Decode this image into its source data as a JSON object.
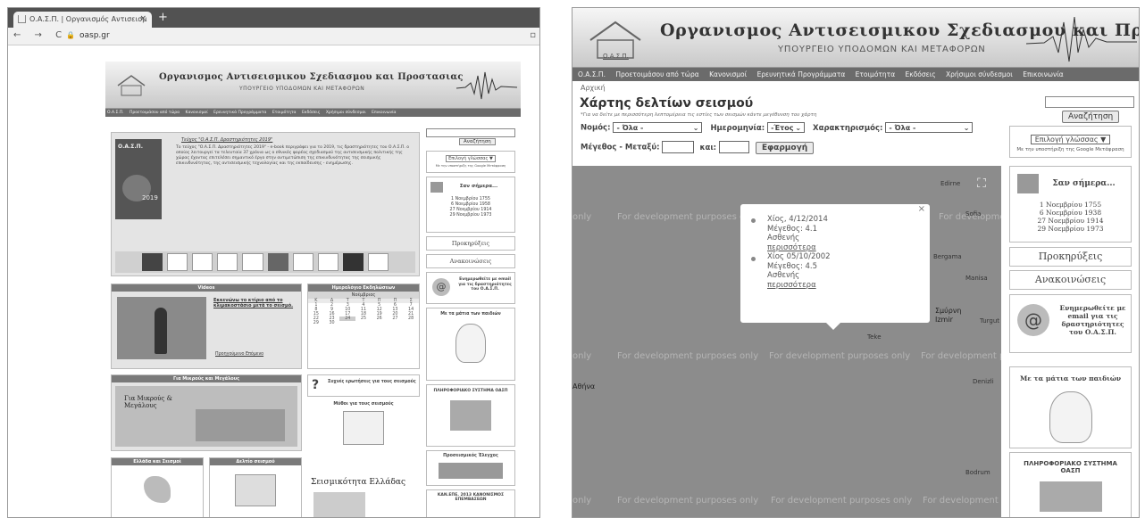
{
  "left": {
    "tab_title": "Ο.Α.Σ.Π. | Οργανισμός Αντισεισμ",
    "tab_close": "×",
    "new_tab": "+",
    "nav_glyphs": "← → C",
    "lock_icon": "🔒",
    "url": "oasp.gr",
    "site": {
      "title": "Οργανισμος Αντισεισμικου Σχεδιασμου και Προστασιας",
      "subtitle": "ΥΠΟΥΡΓΕΙΟ ΥΠΟΔΟΜΩΝ ΚΑΙ ΜΕΤΑΦΟΡΩΝ",
      "nav": [
        "Ο.Α.Σ.Π.",
        "Προετοιμάσου από τώρα",
        "Κανονισμοί",
        "Ερευνητικά Προγράμματα",
        "Ετοιμότητα",
        "Εκδόσεις",
        "Χρήσιμοι σύνδεσμοι",
        "Επικοινωνία"
      ],
      "feature_title": "Τεύχος \"Ο.Α.Σ.Π. Δραστηριότητες 2019\"",
      "feature_text": "Το τεύχος \"Ο.Α.Σ.Π. Δραστηριότητες 2019\" - e-book περιγράφει για το 2019, τις δραστηριότητες του Ο.Α.Σ.Π. ο οποίος λειτουργεί τα τελευταία 37 χρόνια ως ο εθνικός φορέας σχεδιασμού της αντισεισμικής πολιτικής της χώρας έχοντας επιτελέσει σημαντικό έργο στην αντιμετώπιση της επικινδυνότητας της σεισμικής επικινδυνότητας, της αντισεισμικής τεχνολογίας και της εκπαίδευσης - ενημέρωσης.",
      "book_year": "2019",
      "book_label": "Ο.Α.Σ.Π.",
      "search_button": "Αναζήτηση",
      "language_select": "Επιλογή γλώσσας ▼",
      "translate_note": "Με την υποστήριξη της Google Μετάφραση",
      "today_title": "Σαν σήμερα...",
      "today_items": [
        "1 Νοεμβρίου 1755",
        "6 Νοεμβρίου 1958",
        "27 Νοεμβρίου 1914",
        "29 Νοεμβρίου 1973"
      ],
      "forecasts": "Προκηρύξεις",
      "announcements": "Ανακοινώσεις",
      "email_text": "Ενημερωθείτε με email για τις δραστηριότητες του Ο.Α.Σ.Π.",
      "kids": "Με τα μάτια των παιδιών",
      "info_system": "ΠΛΗΡΟΦΟΡΙΑΚΟ ΣΥΣΤΗΜΑ ΟΑΣΠ",
      "preseismic": "Προσεισμικός Έλεγχος",
      "kanepe": "ΚΑΝ.ΕΠΕ. 2013 ΚΑΝΟΝΙΣΜΟΣ ΕΠΕΜΒΑΣΕΩΝ",
      "videos_header": "Videos",
      "video_link": "Εκκενώνω το κτίριο από το κλιμακοστάσιο μετά το σεισμό.",
      "video_links2": "Προηγούμενο  Επόμενο",
      "calendar_header": "Ημερολόγιο Εκδηλώσεων",
      "calendar_month": "Νοέμβριος",
      "calendar_days": [
        "Κ",
        "Δ",
        "Τ",
        "Τ",
        "Π",
        "Π",
        "Σ"
      ],
      "calendar_rows": [
        [
          "1",
          "2",
          "3",
          "4",
          "5",
          "6",
          "7"
        ],
        [
          "8",
          "9",
          "10",
          "11",
          "12",
          "13",
          "14"
        ],
        [
          "15",
          "16",
          "17",
          "18",
          "19",
          "20",
          "21"
        ],
        [
          "22",
          "23",
          "24",
          "25",
          "26",
          "27",
          "28"
        ],
        [
          "29",
          "30",
          "",
          "",
          "",
          "",
          ""
        ]
      ],
      "small_big_header": "Για Μικρούς και Μεγάλους",
      "small_big_banner": "Για Μικρούς & Μεγάλους",
      "questions": "Συχνές ερωτήσεις για τους σεισμούς",
      "myths": "Μύθοι για τους σεισμούς",
      "greece_header": "Ελλάδα και Σεισμοί",
      "bulletin_header": "Δελτίο σεισμού",
      "seismicity": "Σεισμικότητα Ελλάδας"
    }
  },
  "right": {
    "title": "Οργανισμος Αντισεισμικου Σχεδιασμου και Προστασιας",
    "subtitle": "ΥΠΟΥΡΓΕΙΟ ΥΠΟΔΟΜΩΝ ΚΑΙ ΜΕΤΑΦΟΡΩΝ",
    "logo_text": "Ο.Α.Σ.Π.",
    "nav": [
      "Ο.Α.Σ.Π.",
      "Προετοιμάσου από τώρα",
      "Κανονισμοί",
      "Ερευνητικά Προγράμματα",
      "Ετοιμότητα",
      "Εκδόσεις",
      "Χρήσιμοι σύνδεσμοι",
      "Επικοινωνία"
    ],
    "breadcrumb": "Αρχική",
    "page_title": "Χάρτης δελτίων σεισμού",
    "page_note": "*Για να δείτε με περισσότερη λεπτομέρεια τις εστίες των σεισμών κάντε μεγέθυνση του χάρτη",
    "filters": {
      "prefecture_label": "Νομός:",
      "prefecture_value": "- Όλα -",
      "date_label": "Ημερομηνία:",
      "date_value": "-Έτος",
      "character_label": "Χαρακτηρισμός:",
      "character_value": "- Όλα -",
      "magnitude_label": "Μέγεθος - Μεταξύ:",
      "and_label": "και:",
      "apply_button": "Εφαρμογή"
    },
    "search_button": "Αναζήτηση",
    "language_select": "Επιλογή γλώσσας ▼",
    "translate_note": "Με την υποστήριξη της Google Μετάφραση",
    "today_title": "Σαν σήμερα...",
    "today_items": [
      "1 Νοεμβρίου 1755",
      "6 Νοεμβρίου 1938",
      "27 Νοεμβρίου 1914",
      "29 Νοεμβρίου 1973"
    ],
    "forecasts": "Προκηρύξεις",
    "announcements": "Ανακοινώσεις",
    "email_text": "Ενημερωθείτε με email για τις δραστηριότητες του Ο.Α.Σ.Π.",
    "kids": "Με τα μάτια των παιδιών",
    "info_system": "ΠΛΗΡΟΦΟΡΙΑΚΟ ΣΥΣΤΗΜΑ ΟΑΣΠ",
    "map": {
      "dev_text": "For development purposes only",
      "only_text": "only",
      "places": [
        "Edirne",
        "Sofia",
        "Bergama",
        "Manisa",
        "Izmir",
        "Σμύρνη",
        "Turgut",
        "Denizli",
        "Αθήνα",
        "Bodrum",
        "Teke"
      ],
      "popup": {
        "close": "×",
        "entries": [
          {
            "location": "Χίος, 4/12/2014",
            "magnitude": "Μέγεθος: 4.1",
            "character": "Ασθενής",
            "more": "περισσότερα"
          },
          {
            "location": "Χίος 05/10/2002",
            "magnitude": "Μέγεθος: 4.5",
            "character": "Ασθενής",
            "more": "περισσότερα"
          }
        ]
      }
    }
  }
}
